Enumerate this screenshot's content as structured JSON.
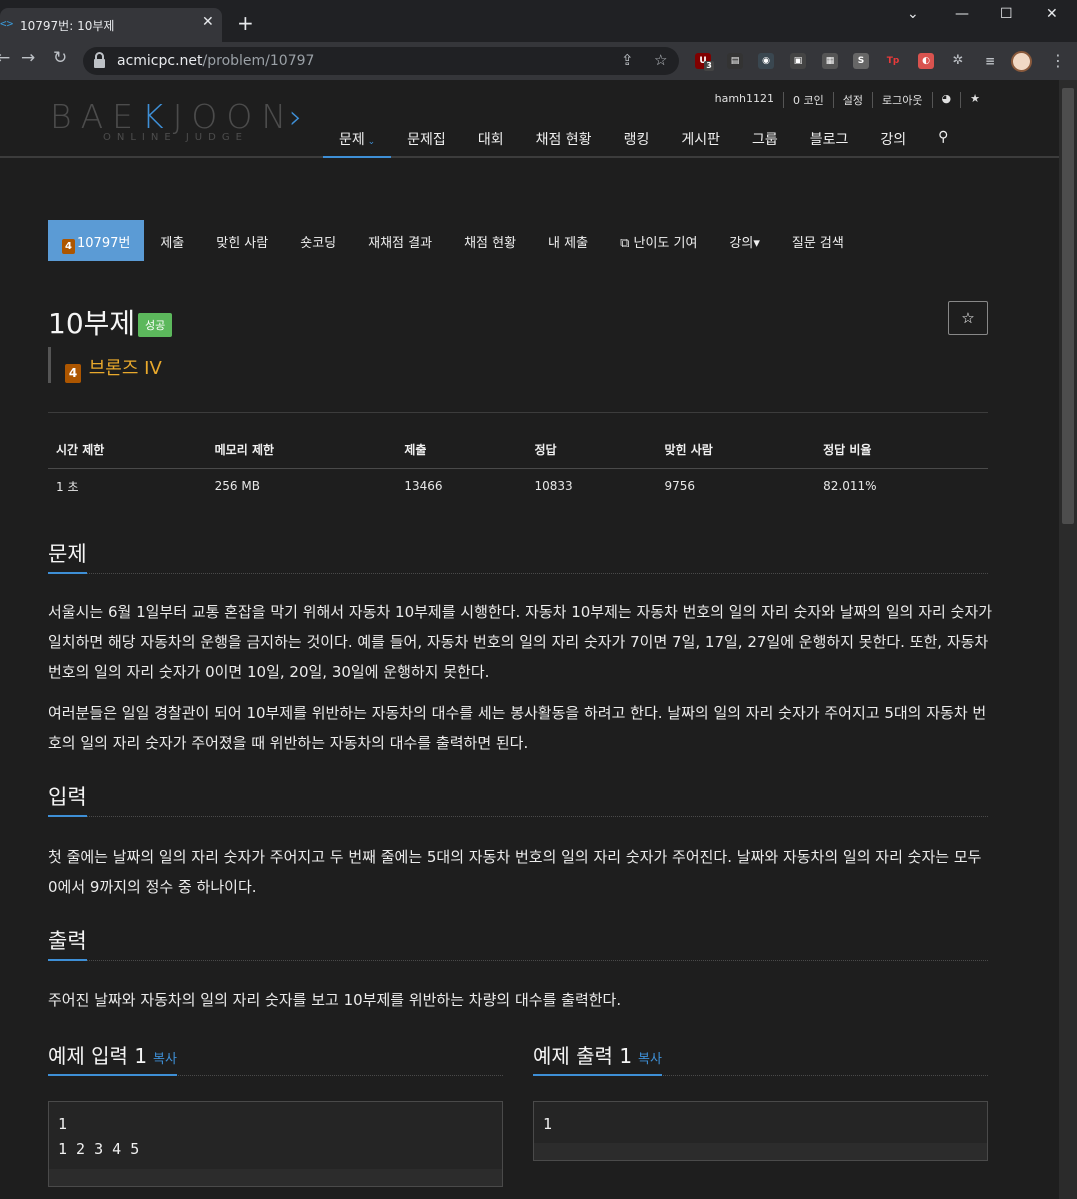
{
  "browser": {
    "tab_title": "10797번: 10부제",
    "tab_favicon": "<>",
    "url_host": "acmicpc.net",
    "url_path": "/problem/10797",
    "ext_badge_count": "3"
  },
  "site": {
    "logo_left": "BAE",
    "logo_k": "K",
    "logo_right": "JOON",
    "logo_sub": "ONLINE JUDGE",
    "userbar": [
      "hamh1121",
      "0 코인",
      "설정",
      "로그아웃",
      "◕",
      "★"
    ],
    "nav": [
      "문제",
      "문제집",
      "대회",
      "채점 현황",
      "랭킹",
      "게시판",
      "그룹",
      "블로그",
      "강의"
    ]
  },
  "subnav": {
    "problem_tab": "10797번",
    "tier_digit": "4",
    "items": [
      "제출",
      "맞힌 사람",
      "숏코딩",
      "재채점 결과",
      "채점 현황",
      "내 제출",
      "난이도 기여",
      "강의▾",
      "질문 검색"
    ]
  },
  "problem": {
    "title": "10부제",
    "status_badge": "성공",
    "tier_label": "브론즈 IV",
    "favorite_icon": "☆"
  },
  "info_table": {
    "headers": [
      "시간 제한",
      "메모리 제한",
      "제출",
      "정답",
      "맞힌 사람",
      "정답 비율"
    ],
    "values": [
      "1 초",
      "256 MB",
      "13466",
      "10833",
      "9756",
      "82.011%"
    ]
  },
  "sections": {
    "description_title": "문제",
    "description_p1": "서울시는 6월 1일부터 교통 혼잡을 막기 위해서 자동차 10부제를 시행한다. 자동차 10부제는 자동차 번호의 일의 자리 숫자와 날짜의 일의 자리 숫자가 일치하면 해당 자동차의 운행을 금지하는 것이다. 예를 들어, 자동차 번호의 일의 자리 숫자가 7이면 7일, 17일, 27일에 운행하지 못한다. 또한, 자동차 번호의 일의 자리 숫자가 0이면 10일, 20일, 30일에 운행하지 못한다.",
    "description_p2": "여러분들은 일일 경찰관이 되어 10부제를 위반하는 자동차의 대수를 세는 봉사활동을 하려고 한다. 날짜의 일의 자리 숫자가 주어지고 5대의 자동차 번호의 일의 자리 숫자가 주어졌을 때 위반하는 자동차의 대수를 출력하면 된다.",
    "input_title": "입력",
    "input_text": "첫 줄에는 날짜의 일의 자리 숫자가 주어지고 두 번째 줄에는 5대의 자동차 번호의 일의 자리 숫자가 주어진다. 날짜와 자동차의 일의 자리 숫자는 모두 0에서 9까지의 정수 중 하나이다.",
    "output_title": "출력",
    "output_text": "주어진 날짜와 자동차의 일의 자리 숫자를 보고 10부제를 위반하는 차량의 대수를 출력한다."
  },
  "samples": {
    "input_title": "예제 입력 1",
    "output_title": "예제 출력 1",
    "copy_label": "복사",
    "input_code": "1\n1 2 3 4 5",
    "output_code": "1"
  }
}
